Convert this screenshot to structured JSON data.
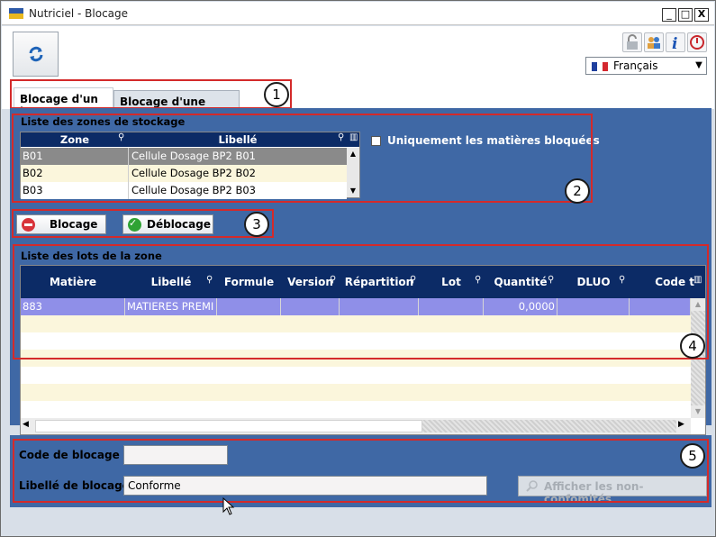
{
  "window": {
    "title": "Nutriciel - Blocage",
    "minimize": "_",
    "maximize": "□",
    "close": "X"
  },
  "toolbar": {
    "language": "Français"
  },
  "tabs": [
    {
      "label": "Blocage d'un lot"
    },
    {
      "label": "Blocage d'une palette"
    }
  ],
  "zones": {
    "section_title": "Liste des zones de stockage",
    "columns": [
      "Zone",
      "Libellé"
    ],
    "rows": [
      {
        "zone": "B01",
        "libelle": "Cellule Dosage BP2 B01"
      },
      {
        "zone": "B02",
        "libelle": "Cellule Dosage BP2 B02"
      },
      {
        "zone": "B03",
        "libelle": "Cellule Dosage BP2 B03"
      }
    ],
    "filter_label": "Uniquement les matières bloquées"
  },
  "actions": {
    "block_label": "Blocage",
    "unblock_label": "Déblocage"
  },
  "lots": {
    "section_title": "Liste des lots de la zone",
    "columns": [
      "Matière",
      "Libellé",
      "Formule",
      "Version",
      "Répartition",
      "Lot",
      "Quantité",
      "DLUO",
      "Code t"
    ],
    "rows": [
      {
        "matiere": "883",
        "libelle": "MATIERES PREMI",
        "formule": "",
        "version": "",
        "repartition": "",
        "lot": "",
        "quantite": "0,0000",
        "dluo": "",
        "code": ""
      }
    ]
  },
  "form": {
    "code_label": "Code de blocage",
    "code_value": "",
    "libelle_label": "Libellé de blocage",
    "libelle_value": "Conforme",
    "nonconf_button": "Afficher les non-confomités"
  },
  "markers": [
    "1",
    "2",
    "3",
    "4",
    "5"
  ],
  "colors": {
    "panel": "#3f68a5",
    "header": "#0c2b66",
    "annotation": "#d42a2a",
    "selected_row": "#8f8fe8"
  }
}
